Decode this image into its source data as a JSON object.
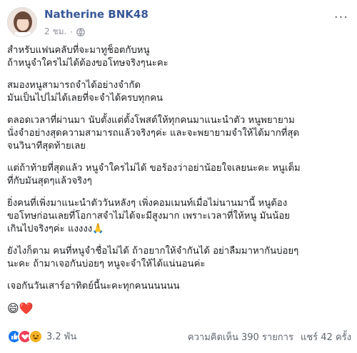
{
  "post": {
    "author": "Natherine BNK48",
    "time": "2 ชม.",
    "privacy_icon": "globe-icon",
    "more_label": "···",
    "paragraphs": [
      [
        "สำหรับแฟนคลับที่จะมาทูช็อตกับหนู",
        "ถ้าหนูจำใครไม่ได้ต้องขอโทษจริงๆนะคะ"
      ],
      [
        "สมองหนูสามารถจำได้อย่างจำกัด",
        "มันเป็นไปไม่ได้เลยที่จะจำได้ครบทุกคน"
      ],
      [
        "ตลอดเวลาที่ผ่านมา นับตั้งแต่ตั้งโพสต์ให้ทุกคนมาแนะนำตัว หนูพยายาม",
        "นั่งจำอย่างสุดความสามารถแล้วจริงๆค่ะ และจะพยายามจำให้ได้มากที่สุด",
        "จนวินาทีสุดท้ายเลย"
      ],
      [
        "แต่ถ้าท้ายที่สุดแล้ว หนูจำใครไม่ได้ ขอร้องว่าอย่าน้อยใจเลยนะคะ หนูเต็ม",
        "ที่กับมันสุดๆแล้วจริงๆ"
      ],
      [
        "ยิ่งคนที่เพิ่งมาแนะนำตัววันหลังๆ เพิ่งคอมเมนท์เมื่อไม่นานมานี้ หนูต้อง",
        "ขอโทษก่อนเลยที่โอกาสจำไม่ได้จะมีสูงมาก เพราะเวลาที่ให้หนู มันน้อย",
        "เกินไปจริงๆค่ะ แงงงง🙏"
      ],
      [
        "ยังไงก็ตาม คนที่หนูจำชื่อไม่ได้ ถ้าอยากให้จำกันได้ อย่าลืมมาหากันบ่อยๆ",
        "นะคะ ถ้ามาเจอกันบ่อยๆ หนูจะจำให้ได้แน่นอนค่ะ"
      ],
      [
        "เจอกันวันเสาร์อาทิตย์นี้นะคะทุกคนนนนนน"
      ]
    ],
    "emoji_line": "😄❤️"
  },
  "footer": {
    "reactions": [
      "like-reaction-icon",
      "love-reaction-icon",
      "haha-reaction-icon"
    ],
    "reaction_count": "3.2 พัน",
    "comments": "ความคิดเห็น 390 รายการ",
    "shares": "แชร์ 42 ครั้ง"
  },
  "colors": {
    "author": "#385898",
    "meta": "#90949c",
    "like": "#1877f2",
    "love": "#f33e58",
    "haha": "#f7b125"
  }
}
